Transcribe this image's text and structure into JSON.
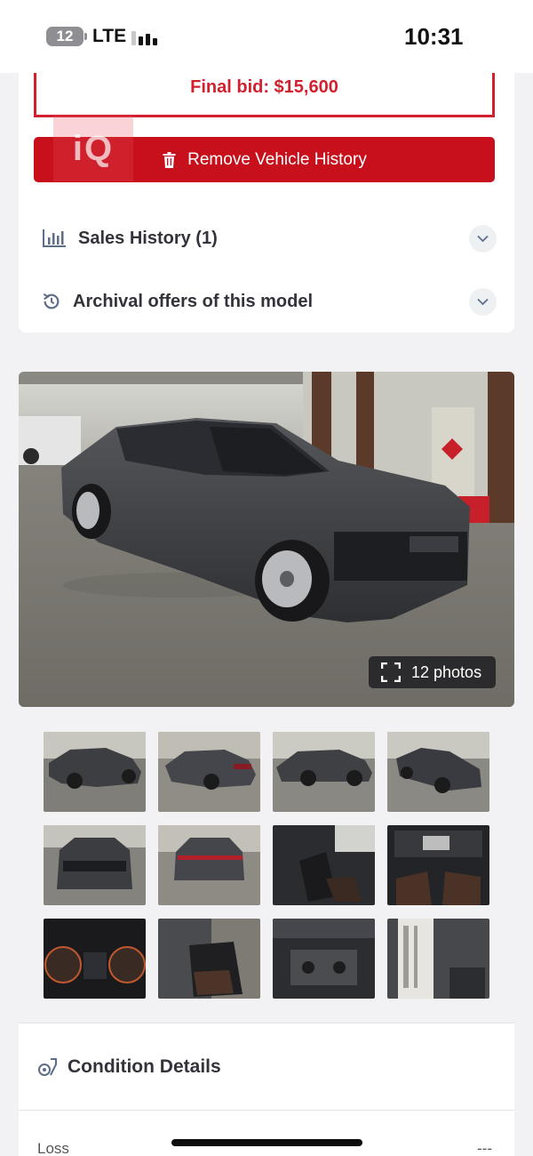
{
  "status_bar": {
    "battery": "12",
    "network": "LTE",
    "time": "10:31"
  },
  "auction": {
    "final_bid": "Final bid: $15,600",
    "watermark": "iQ",
    "remove_history_label": "Remove Vehicle History"
  },
  "accordion": {
    "sales_history": "Sales History (1)",
    "archival_offers": "Archival offers of this model"
  },
  "gallery": {
    "photo_count_label": "12 photos",
    "thumbnails": [
      "front-left exterior",
      "rear-left exterior",
      "left side exterior",
      "front-right exterior",
      "front exterior",
      "rear exterior",
      "front seats interior",
      "dashboard interior",
      "instrument cluster",
      "rear seats interior",
      "engine bay",
      "door jamb label"
    ]
  },
  "condition": {
    "title": "Condition Details",
    "loss_label": "Loss",
    "loss_value": "---"
  },
  "colors": {
    "accent_red": "#c8101d",
    "bid_red": "#d3202f",
    "heading": "#33333b"
  }
}
